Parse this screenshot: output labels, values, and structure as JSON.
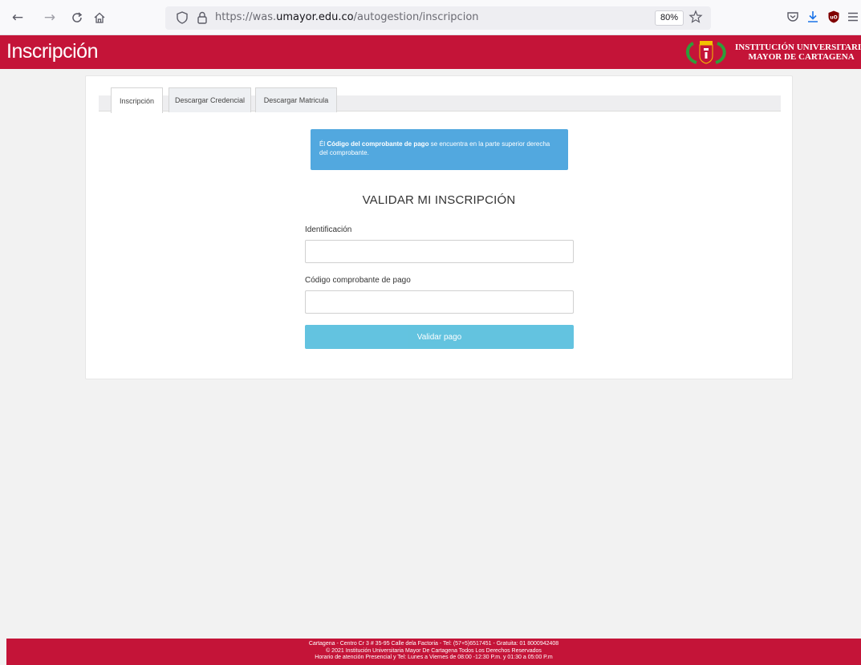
{
  "browser": {
    "url_prefix": "https://was.",
    "url_host": "umayor.edu.co",
    "url_path": "/autogestion/inscripcion",
    "zoom": "80%"
  },
  "header": {
    "title": "Inscripción",
    "institution_line1": "INSTITUCIÓN UNIVERSITARIA",
    "institution_line2": "MAYOR DE CARTAGENA"
  },
  "tabs": [
    {
      "label": "Inscripción",
      "active": true
    },
    {
      "label": "Descargar Credencial",
      "active": false
    },
    {
      "label": "Descargar Matricula",
      "active": false
    }
  ],
  "info": {
    "prefix": "Él ",
    "bold": "Código del comprobante de pago",
    "suffix": " se encuentra en la parte superior derecha del comprobante."
  },
  "form": {
    "title": "VALIDAR MI INSCRIPCIÓN",
    "id_label": "Identificación",
    "id_value": "",
    "code_label": "Código comprobante de pago",
    "code_value": "",
    "submit_label": "Validar pago"
  },
  "footer": {
    "line1": "Cartagena - Centro Cr 3 # 35-95 Calle dela Factoria - Tel: (57+5)6517451 - Gratuita: 01 8000942408",
    "line2": "© 2021 Institución Universitaria Mayor De Cartagena Todos Los Derechos Reservados",
    "line3": "Horario de atención Presencial y Tel: Lunes a Viernes de 08:00 -12:30 P.m. y 01:30 a 05:00 P.m"
  },
  "colors": {
    "brand_red": "#c41438",
    "info_blue": "#52a8df",
    "button_blue": "#5bc0de"
  }
}
